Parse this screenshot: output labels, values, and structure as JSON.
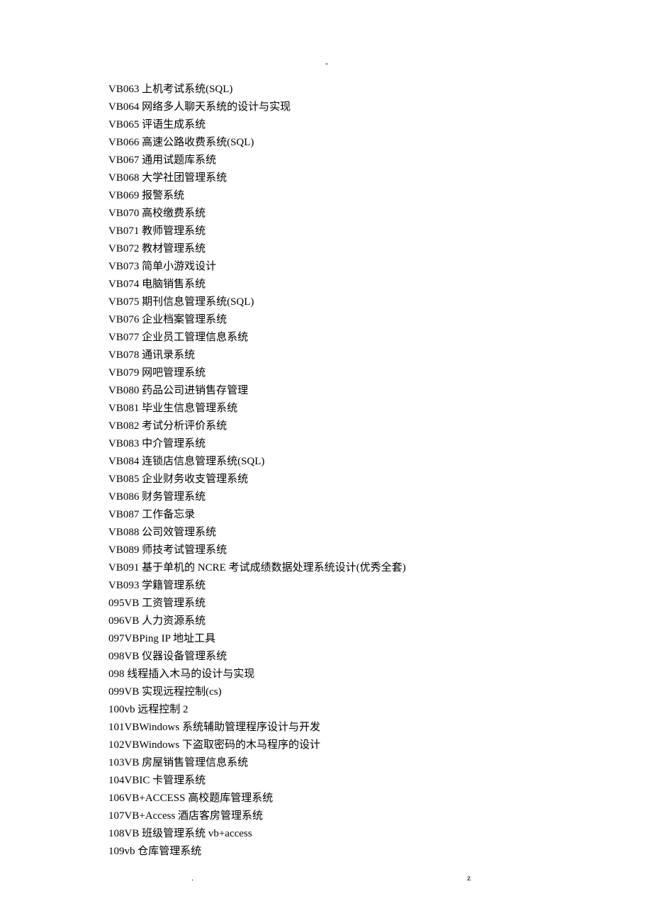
{
  "header": {
    "mark": "-"
  },
  "footer": {
    "left": ".",
    "right": "z"
  },
  "list": {
    "items": [
      "VB063 上机考试系统(SQL)",
      "VB064 网络多人聊天系统的设计与实现",
      "VB065 评语生成系统",
      "VB066 高速公路收费系统(SQL)",
      "VB067 通用试题库系统",
      "VB068 大学社团管理系统",
      "VB069 报警系统",
      "VB070 高校缴费系统",
      "VB071 教师管理系统",
      "VB072 教材管理系统",
      "VB073 简单小游戏设计",
      "VB074 电脑销售系统",
      "VB075 期刊信息管理系统(SQL)",
      "VB076 企业档案管理系统",
      "VB077 企业员工管理信息系统",
      "VB078 通讯录系统",
      "VB079 网吧管理系统",
      "VB080 药品公司进销售存管理",
      "VB081 毕业生信息管理系统",
      "VB082 考试分析评价系统",
      "VB083 中介管理系统",
      "VB084 连锁店信息管理系统(SQL)",
      "VB085 企业财务收支管理系统",
      "VB086 财务管理系统",
      "VB087 工作备忘录",
      "VB088 公司效管理系统",
      "VB089 师技考试管理系统",
      "VB091 基于单机的 NCRE 考试成绩数据处理系统设计(优秀全套)",
      "VB093 学籍管理系统",
      "095VB 工资管理系统",
      "096VB 人力资源系统",
      "097VBPing IP 地址工具",
      "098VB 仪器设备管理系统",
      "098 线程插入木马的设计与实现",
      "099VB 实现远程控制(cs)",
      "100vb 远程控制 2",
      "101VBWindows 系统辅助管理程序设计与开发",
      "102VBWindows 下盗取密码的木马程序的设计",
      "103VB 房屋销售管理信息系统",
      "104VBIC 卡管理系统",
      "106VB+ACCESS 高校题库管理系统",
      "107VB+Access 酒店客房管理系统",
      "108VB 班级管理系统 vb+access",
      "109vb 仓库管理系统"
    ]
  }
}
